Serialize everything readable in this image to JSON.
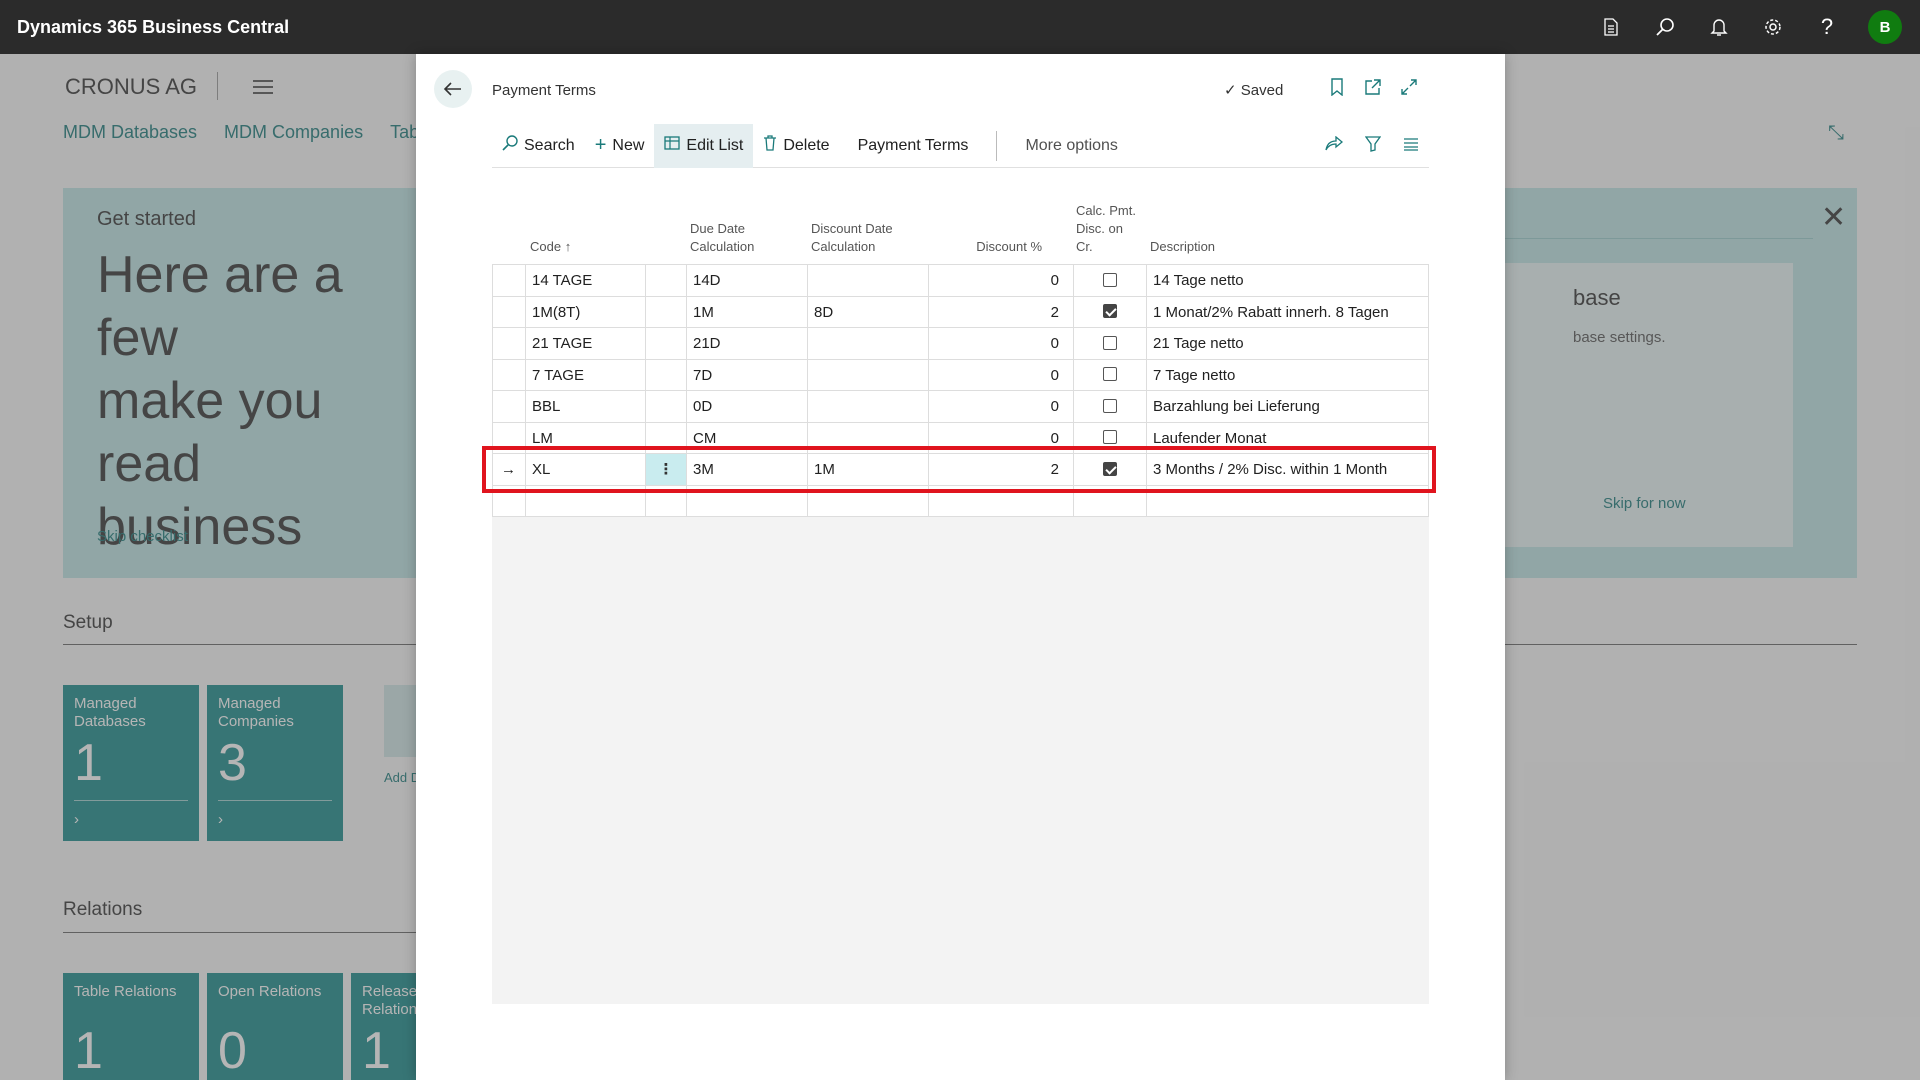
{
  "app": {
    "title": "Dynamics 365 Business Central",
    "avatar_letter": "B",
    "icons": [
      "document-icon",
      "search-icon",
      "bell-icon",
      "gear-icon",
      "help-icon"
    ]
  },
  "background": {
    "company": "CRONUS AG",
    "nav_links": [
      "MDM Databases",
      "MDM Companies",
      "Tabl"
    ],
    "banner": {
      "label": "Get started",
      "headline": "Here are a few\nmake you read\nbusiness",
      "skip_checklist": "Skip checklist",
      "card_title": "base",
      "card_sub": "base settings.",
      "card_skip": "Skip for now"
    },
    "setup_title": "Setup",
    "setup_tiles": [
      {
        "label": "Managed Databases",
        "value": "1"
      },
      {
        "label": "Managed Companies",
        "value": "3"
      }
    ],
    "add_label": "Add D",
    "relations_title": "Relations",
    "relations_tiles": [
      {
        "label": "Table Relations",
        "value": "1"
      },
      {
        "label": "Open Relations",
        "value": "0"
      },
      {
        "label": "Released Relation",
        "value": "1"
      }
    ]
  },
  "dialog": {
    "title": "Payment Terms",
    "saved": "Saved",
    "actions": {
      "search": "Search",
      "new": "New",
      "edit_list": "Edit List",
      "delete": "Delete",
      "payment_terms": "Payment Terms",
      "more_options": "More options"
    },
    "columns": {
      "code": "Code",
      "due_date": "Due Date Calculation",
      "discount_date": "Discount Date Calculation",
      "discount_pct": "Discount %",
      "calc_pmt": "Calc. Pmt. Disc. on Cr.",
      "description": "Description"
    },
    "rows": [
      {
        "code": "14 TAGE",
        "due": "14D",
        "disc_date": "",
        "disc_pct": "0",
        "calc": false,
        "desc": "14 Tage netto"
      },
      {
        "code": "1M(8T)",
        "due": "1M",
        "disc_date": "8D",
        "disc_pct": "2",
        "calc": true,
        "desc": "1 Monat/2% Rabatt innerh. 8 Tagen"
      },
      {
        "code": "21 TAGE",
        "due": "21D",
        "disc_date": "",
        "disc_pct": "0",
        "calc": false,
        "desc": "21 Tage netto"
      },
      {
        "code": "7 TAGE",
        "due": "7D",
        "disc_date": "",
        "disc_pct": "0",
        "calc": false,
        "desc": "7 Tage netto"
      },
      {
        "code": "BBL",
        "due": "0D",
        "disc_date": "",
        "disc_pct": "0",
        "calc": false,
        "desc": "Barzahlung bei Lieferung"
      },
      {
        "code": "LM",
        "due": "CM",
        "disc_date": "",
        "disc_pct": "0",
        "calc": false,
        "desc": "Laufender Monat"
      },
      {
        "code": "XL",
        "due": "3M",
        "disc_date": "1M",
        "disc_pct": "2",
        "calc": true,
        "desc": "3 Months / 2% Disc. within 1 Month",
        "current": true
      },
      {
        "code": "",
        "due": "",
        "disc_date": "",
        "disc_pct": "",
        "calc": null,
        "desc": ""
      }
    ]
  }
}
